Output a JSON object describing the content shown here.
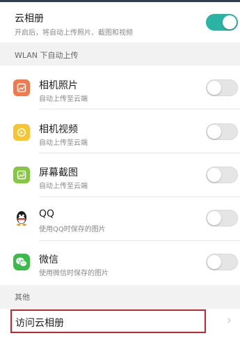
{
  "cloud_album": {
    "title": "云相册",
    "subtitle": "开启后，将自动上传照片、截图和视频",
    "enabled": true
  },
  "wlan_section": {
    "header": "WLAN 下自动上传",
    "items": [
      {
        "title": "相机照片",
        "subtitle": "自动上传至云端",
        "icon": "camera-photo-icon",
        "icon_color": "#f07a4b",
        "enabled": false
      },
      {
        "title": "相机视频",
        "subtitle": "自动上传至云端",
        "icon": "camera-video-icon",
        "icon_color": "#f7c531",
        "enabled": false
      },
      {
        "title": "屏幕截图",
        "subtitle": "自动上传至云端",
        "icon": "screenshot-icon",
        "icon_color": "#84c840",
        "enabled": false
      },
      {
        "title": "QQ",
        "subtitle": "使用QQ时保存的图片",
        "icon": "qq-icon",
        "icon_color": "#1b1b1b",
        "enabled": false
      },
      {
        "title": "微信",
        "subtitle": "使用微信时保存的图片",
        "icon": "wechat-icon",
        "icon_color": "#3dbb4a",
        "enabled": false
      }
    ]
  },
  "other_section": {
    "header": "其他",
    "visit_label": "访问云相册"
  },
  "colors": {
    "toggle_on": "#2bb3a3",
    "highlight_border": "#c0282d"
  }
}
